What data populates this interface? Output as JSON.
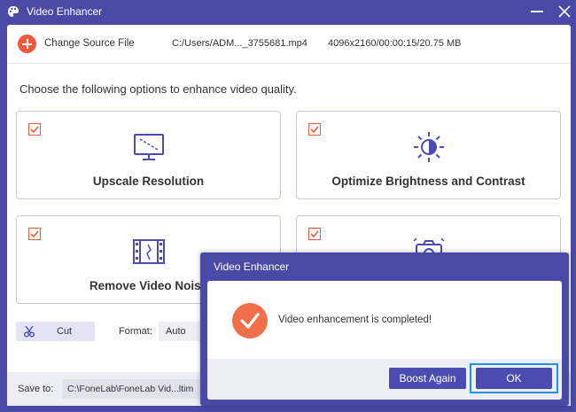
{
  "window": {
    "title": "Video Enhancer"
  },
  "source": {
    "change_label": "Change Source File",
    "file_path": "C:/Users/ADM..._3755681.mp4",
    "file_info": "4096x2160/00:00:15/20.75 MB"
  },
  "instruction": "Choose the following options to enhance video quality.",
  "options": [
    {
      "label": "Upscale Resolution",
      "checked": true,
      "icon": "monitor-icon"
    },
    {
      "label": "Optimize Brightness and Contrast",
      "checked": true,
      "icon": "brightness-icon"
    },
    {
      "label": "Remove Video Noise",
      "checked": true,
      "icon": "film-icon"
    },
    {
      "label": "",
      "checked": true,
      "icon": "camera-shake-icon"
    }
  ],
  "toolbar": {
    "cut_label": "Cut",
    "format_label": "Format:",
    "format_value": "Auto"
  },
  "footer": {
    "save_label": "Save to:",
    "save_path": "C:\\FoneLab\\FoneLab Vid...ltim"
  },
  "dialog": {
    "title": "Video Enhancer",
    "message": "Video enhancement is completed!",
    "boost_label": "Boost Again",
    "ok_label": "OK"
  },
  "colors": {
    "accent": "#4b4bb2",
    "orange": "#ef5a3a",
    "highlight": "#1e90e6"
  }
}
